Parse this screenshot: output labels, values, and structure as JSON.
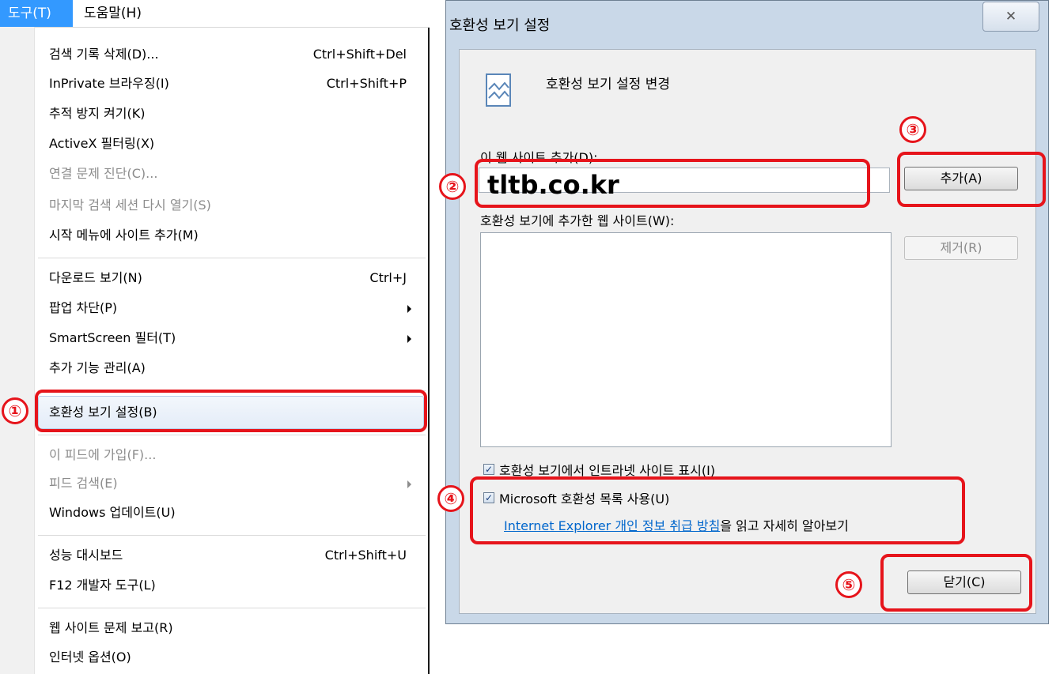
{
  "menu": {
    "bar": {
      "tools": "도구(T)",
      "help": "도움말(H)"
    },
    "items": [
      {
        "label": "검색 기록 삭제(D)...",
        "shortcut": "Ctrl+Shift+Del"
      },
      {
        "label": "InPrivate 브라우징(I)",
        "shortcut": "Ctrl+Shift+P"
      },
      {
        "label": "추적 방지 켜기(K)"
      },
      {
        "label": "ActiveX 필터링(X)"
      },
      {
        "label": "연결 문제 진단(C)..."
      },
      {
        "label": "마지막 검색 세션 다시 열기(S)"
      },
      {
        "label": "시작 메뉴에 사이트 추가(M)"
      },
      {
        "label": "다운로드 보기(N)",
        "shortcut": "Ctrl+J"
      },
      {
        "label": "팝업 차단(P)"
      },
      {
        "label": "SmartScreen 필터(T)"
      },
      {
        "label": "추가 기능 관리(A)"
      },
      {
        "label": "호환성 보기 설정(B)"
      },
      {
        "label": "이 피드에 가입(F)..."
      },
      {
        "label": "피드 검색(E)"
      },
      {
        "label": "Windows 업데이트(U)"
      },
      {
        "label": "성능 대시보드",
        "shortcut": "Ctrl+Shift+U"
      },
      {
        "label": "F12 개발자 도구(L)"
      },
      {
        "label": "웹 사이트 문제 보고(R)"
      },
      {
        "label": "인터넷 옵션(O)"
      }
    ]
  },
  "dialog": {
    "title": "호환성 보기 설정",
    "close": "✕",
    "heading": "호환성 보기 설정 변경",
    "add_label": "이 웹 사이트 추가(D):",
    "input_value": "tltb.co.kr",
    "add_button": "추가(A)",
    "list_label": "호환성 보기에 추가한 웹 사이트(W):",
    "remove_button": "제거(R)",
    "option_intranet": "호환성 보기에서 인트라넷 사이트 표시(I)",
    "option_mslist": "Microsoft 호환성 목록 사용(U)",
    "link": "Internet Explorer 개인 정보 취급 방침",
    "link_suffix": "을 읽고 자세히 알아보기",
    "close_button": "닫기(C)"
  },
  "annotations": [
    "①",
    "②",
    "③",
    "④",
    "⑤"
  ],
  "colors": {
    "highlight": "#e6141b",
    "menu_accent": "#3399ff",
    "link": "#0066cc"
  }
}
